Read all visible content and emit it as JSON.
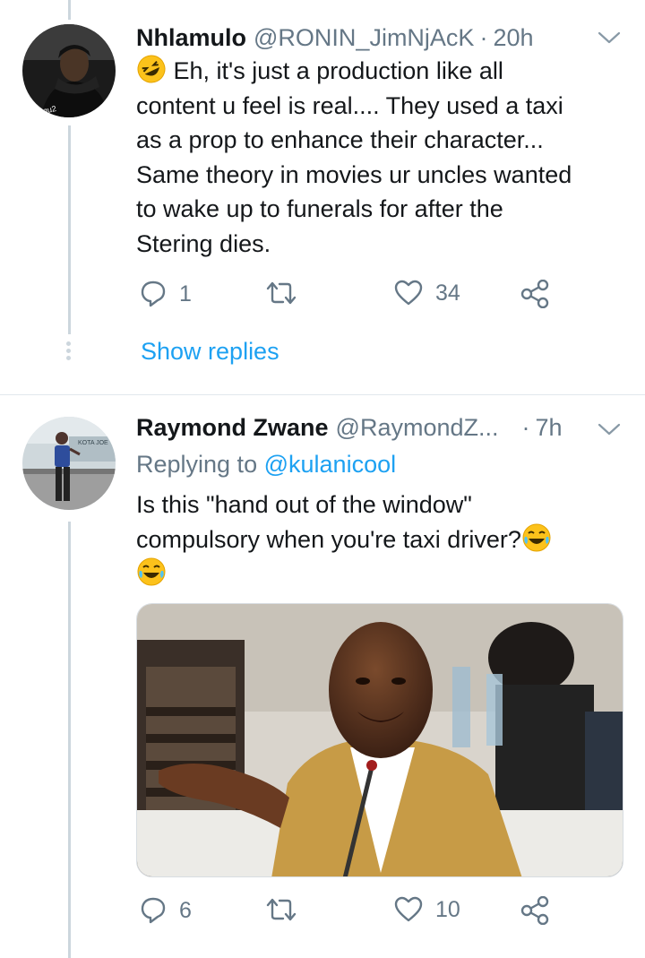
{
  "tweet1": {
    "name": "Nhlamulo",
    "handle": "@RONIN_JimNjAcK",
    "separator": "·",
    "time": "20h",
    "text_lines": [
      "Eh, it's just a production like all",
      "content u feel is real.... They used a taxi",
      "as a prop to enhance their character...",
      "Same theory in movies ur uncles wanted",
      "to wake up to funerals for after the",
      "Stering dies."
    ],
    "avatar_caption": "me qu2",
    "actions": {
      "reply_count": "1",
      "retweet_count": "",
      "like_count": "34"
    },
    "show_replies": "Show replies"
  },
  "tweet2": {
    "name": "Raymond Zwane",
    "handle": "@RaymondZ...",
    "separator": "·",
    "time": "7h",
    "replying_prefix": "Replying to",
    "replying_to": "@kulanicool",
    "text_lines": [
      "Is this \"hand out of the window\"",
      "compulsory when you're taxi driver?"
    ],
    "avatar_sign": "KOTA JOE",
    "actions": {
      "reply_count": "6",
      "retweet_count": "",
      "like_count": "10"
    }
  },
  "colors": {
    "link": "#1da1f2",
    "secondary_text": "#657786",
    "thread_line": "#ccd6dd"
  },
  "icons": [
    "reply-icon",
    "retweet-icon",
    "like-icon",
    "share-icon",
    "chevron-down-icon",
    "laughing-emoji"
  ]
}
